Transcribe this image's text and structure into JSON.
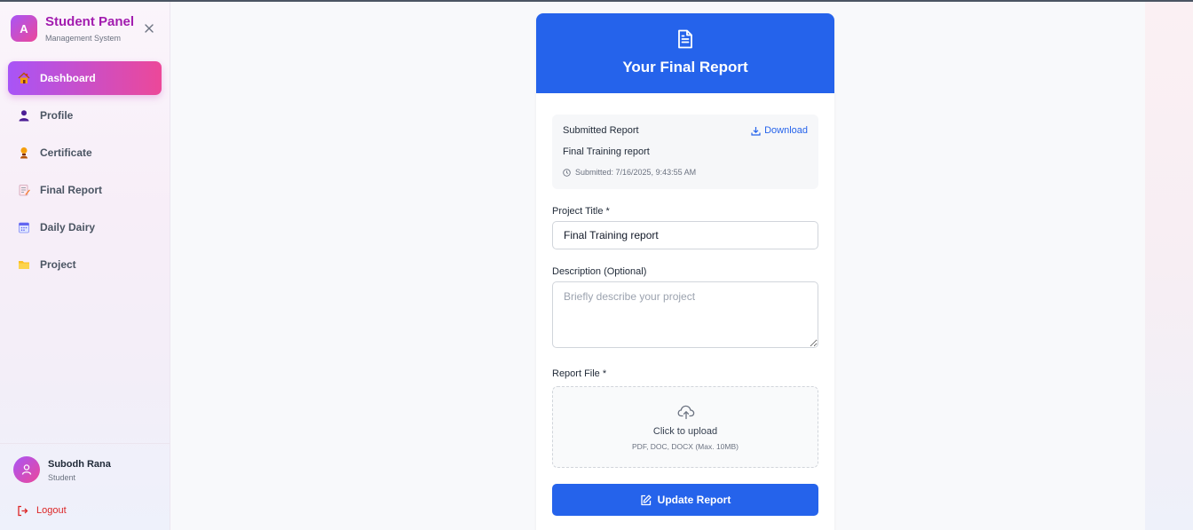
{
  "sidebar": {
    "brand": {
      "logo_letter": "A",
      "title": "Student Panel",
      "subtitle": "Management System"
    },
    "close_icon": "close-icon",
    "items": [
      {
        "label": "Dashboard",
        "icon": "house-icon",
        "active": true
      },
      {
        "label": "Profile",
        "icon": "person-icon",
        "active": false
      },
      {
        "label": "Certificate",
        "icon": "medal-icon",
        "active": false
      },
      {
        "label": "Final Report",
        "icon": "memo-icon",
        "active": false
      },
      {
        "label": "Daily Dairy",
        "icon": "calendar-icon",
        "active": false
      },
      {
        "label": "Project",
        "icon": "folder-icon",
        "active": false
      }
    ],
    "user": {
      "name": "Subodh Rana",
      "role": "Student"
    },
    "logout_label": "Logout"
  },
  "card": {
    "title": "Your Final Report",
    "submitted": {
      "label": "Submitted Report",
      "download_label": "Download",
      "name": "Final Training report",
      "timestamp": "Submitted: 7/16/2025, 9:43:55 AM"
    },
    "project_title": {
      "label": "Project Title *",
      "value": "Final Training report"
    },
    "description": {
      "label": "Description (Optional)",
      "placeholder": "Briefly describe your project"
    },
    "report_file": {
      "label": "Report File *",
      "upload_text": "Click to upload",
      "upload_hint": "PDF, DOC, DOCX (Max. 10MB)"
    },
    "submit_label": "Update Report"
  },
  "colors": {
    "primary": "#2563eb",
    "brand_gradient_start": "#a855f7",
    "brand_gradient_end": "#ec4899",
    "logout": "#dc2626"
  }
}
